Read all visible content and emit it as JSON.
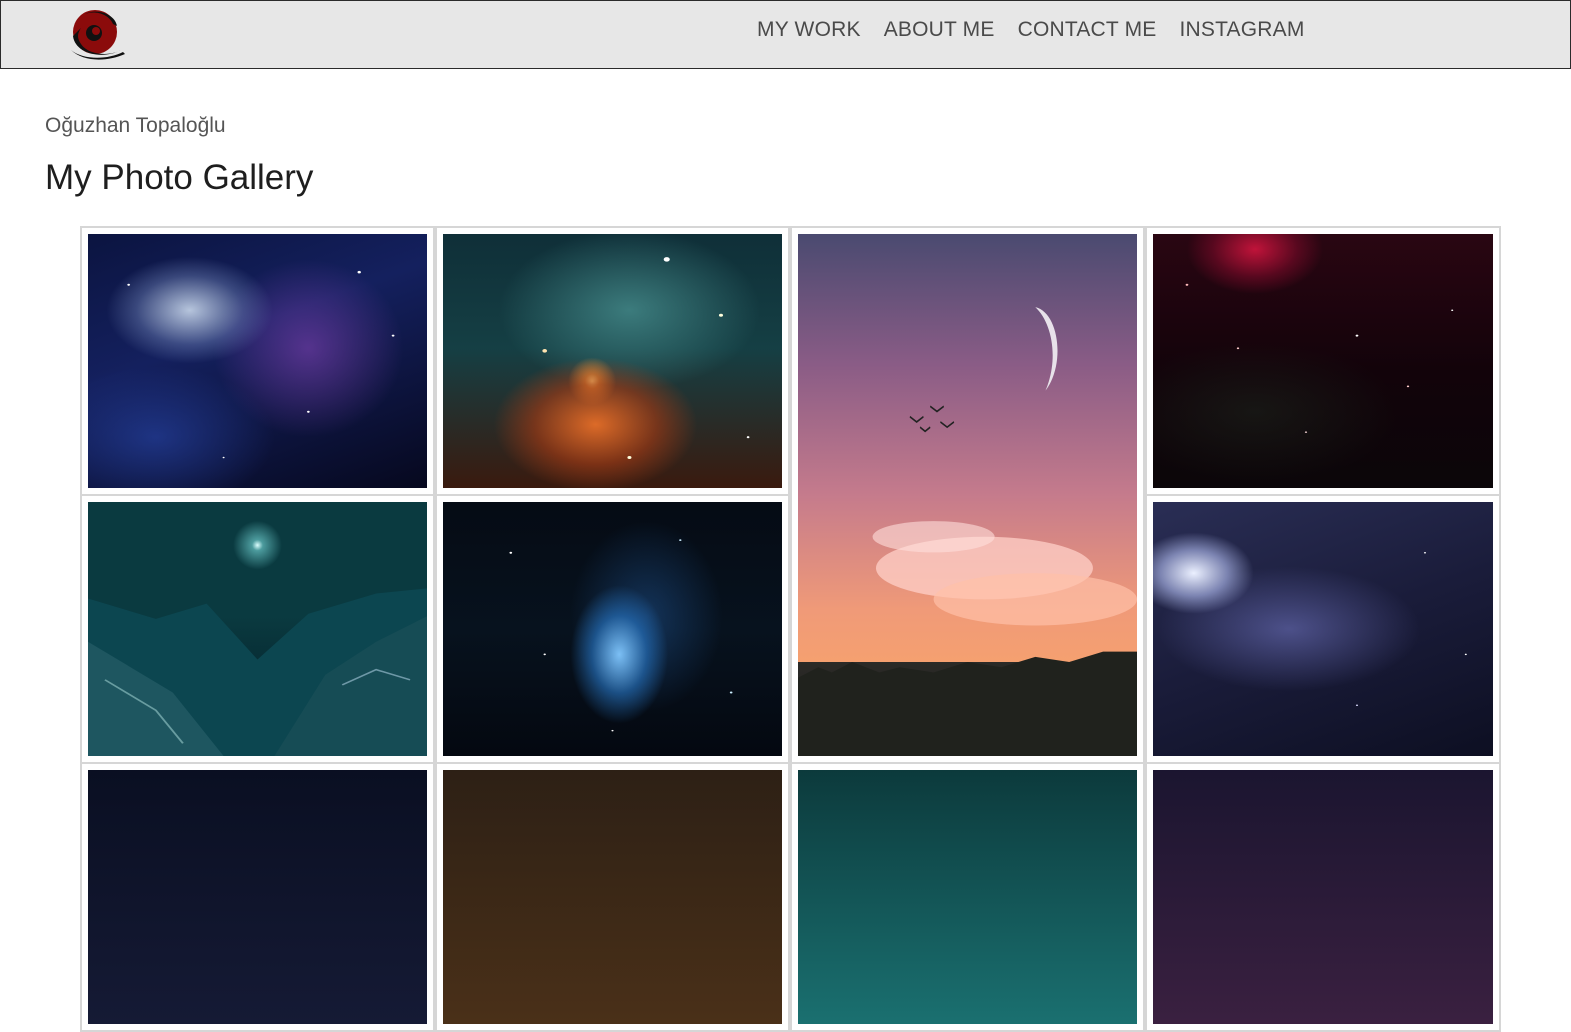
{
  "header": {
    "logo": "swirl-logo",
    "nav": [
      {
        "label": "MY WORK"
      },
      {
        "label": "ABOUT ME"
      },
      {
        "label": "CONTACT ME"
      },
      {
        "label": "INSTAGRAM"
      }
    ]
  },
  "main": {
    "author": "Oğuzhan Topaloğlu",
    "title": "My Photo Gallery"
  },
  "colors": {
    "navbar_bg": "#e7e7e7",
    "logo_red": "#8b0b0b",
    "nav_text": "#4a4a4a",
    "frame_border": "#d6d6d6"
  },
  "gallery": {
    "photos": [
      {
        "subject": "blue-purple-nebula"
      },
      {
        "subject": "orange-teal-nebula"
      },
      {
        "subject": "crescent-moon-sunset-sky-with-birds"
      },
      {
        "subject": "red-starfield"
      },
      {
        "subject": "teal-mountains-under-star"
      },
      {
        "subject": "blue-glowing-nebula-streak"
      },
      {
        "subject": "blue-galaxy"
      },
      {
        "subject": "dark-nebula"
      },
      {
        "subject": "golden-nebula"
      },
      {
        "subject": "teal-nebula"
      },
      {
        "subject": "purple-nebula"
      }
    ]
  }
}
